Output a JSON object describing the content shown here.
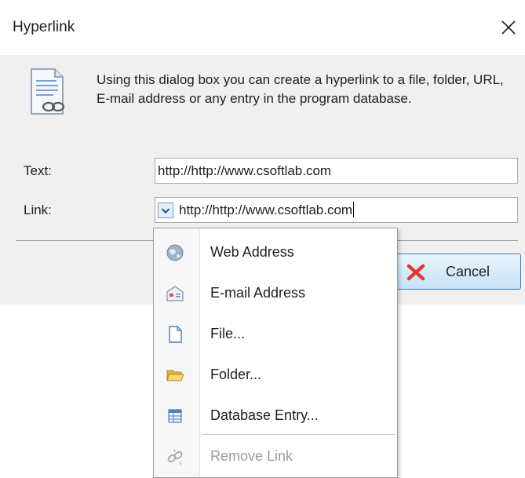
{
  "dialog": {
    "title": "Hyperlink",
    "description": "Using this dialog box  you can create a hyperlink to a file, folder, URL, E-mail address or any entry in the program database.",
    "text_label": "Text:",
    "text_value": "http://http://www.csoftlab.com",
    "link_label": "Link:",
    "link_value": "http://http://www.csoftlab.com",
    "cancel_label": "Cancel"
  },
  "menu": {
    "items": [
      {
        "label": "Web Address",
        "icon": "globe-icon",
        "enabled": true
      },
      {
        "label": "E-mail Address",
        "icon": "envelope-icon",
        "enabled": true
      },
      {
        "label": "File...",
        "icon": "file-icon",
        "enabled": true
      },
      {
        "label": "Folder...",
        "icon": "folder-icon",
        "enabled": true
      },
      {
        "label": "Database Entry...",
        "icon": "database-entry-icon",
        "enabled": true
      },
      {
        "label": "Remove Link",
        "icon": "broken-link-icon",
        "enabled": false
      }
    ]
  },
  "colors": {
    "dialog_bg": "#f0f0f0",
    "button_border": "#3c7fb1",
    "cancel_x": "#e0382c",
    "disabled_text": "#9a9a9a"
  }
}
